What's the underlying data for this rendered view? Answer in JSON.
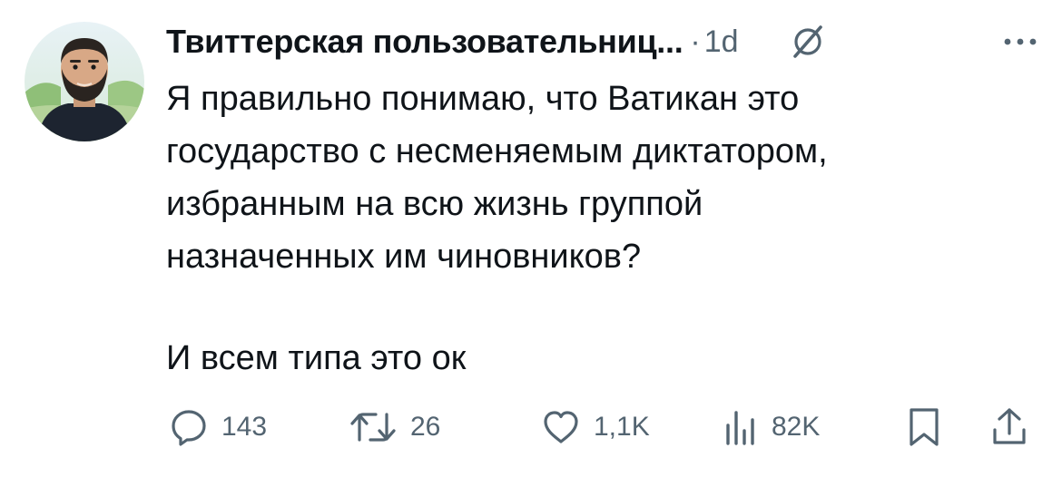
{
  "tweet": {
    "author": {
      "display_name": "Твиттерская пользовательниц...",
      "avatar_icon": "bearded-man-avatar"
    },
    "separator": "·",
    "timestamp": "1d",
    "header_icons": [
      "grok-icon",
      "more-icon"
    ],
    "text_lines": "Я правильно понимаю, что Ватикан это\nгосударство с несменяемым диктатором,\nизбранным на всю жизнь группой\nназначенных им чиновников?",
    "text_last": "И всем типа это ок",
    "actions": {
      "replies": "143",
      "retweets": "26",
      "likes": "1,1K",
      "views": "82K"
    }
  },
  "colors": {
    "text": "#0f1419",
    "secondary": "#536471",
    "background": "#ffffff"
  }
}
